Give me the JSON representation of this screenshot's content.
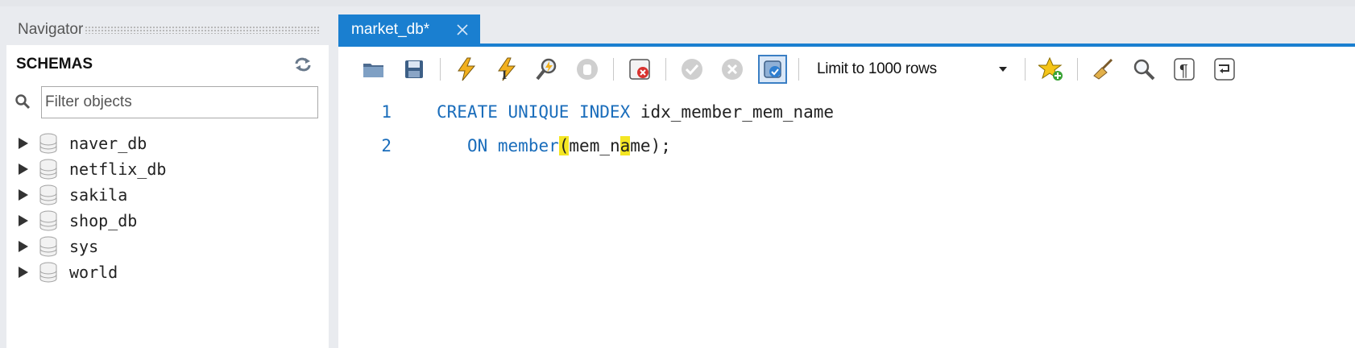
{
  "navigator": {
    "title": "Navigator",
    "schemas_label": "SCHEMAS",
    "filter": {
      "placeholder": "Filter objects",
      "value": ""
    },
    "schemas": [
      {
        "name": "naver_db"
      },
      {
        "name": "netflix_db"
      },
      {
        "name": "sakila"
      },
      {
        "name": "shop_db"
      },
      {
        "name": "sys"
      },
      {
        "name": "world"
      }
    ]
  },
  "editor_tab": {
    "label": "market_db*"
  },
  "toolbar": {
    "buttons": [
      "open-file-icon",
      "save-icon",
      "execute-icon",
      "execute-current-icon",
      "explain-icon",
      "stop-icon",
      "toggle-error-stop-icon",
      "commit-icon",
      "rollback-icon",
      "autocommit-icon",
      "add-snippet-icon",
      "beautify-icon",
      "find-icon",
      "invisible-chars-icon",
      "word-wrap-icon"
    ],
    "limit_select": {
      "selected": "Limit to 1000 rows"
    }
  },
  "code": {
    "lines": [
      {
        "number": "1",
        "kw1": "CREATE UNIQUE INDEX",
        "rest": " idx_member_mem_name"
      },
      {
        "number": "2",
        "indent": "   ",
        "kw1": "ON",
        "kw2": "member",
        "p1": "(",
        "t1": "mem_n",
        "h2": "a",
        "t2": "me);"
      }
    ]
  },
  "colors": {
    "accent": "#1a7fd0",
    "keyword": "#1a6dbb",
    "bracket_highlight": "#f4e623"
  }
}
